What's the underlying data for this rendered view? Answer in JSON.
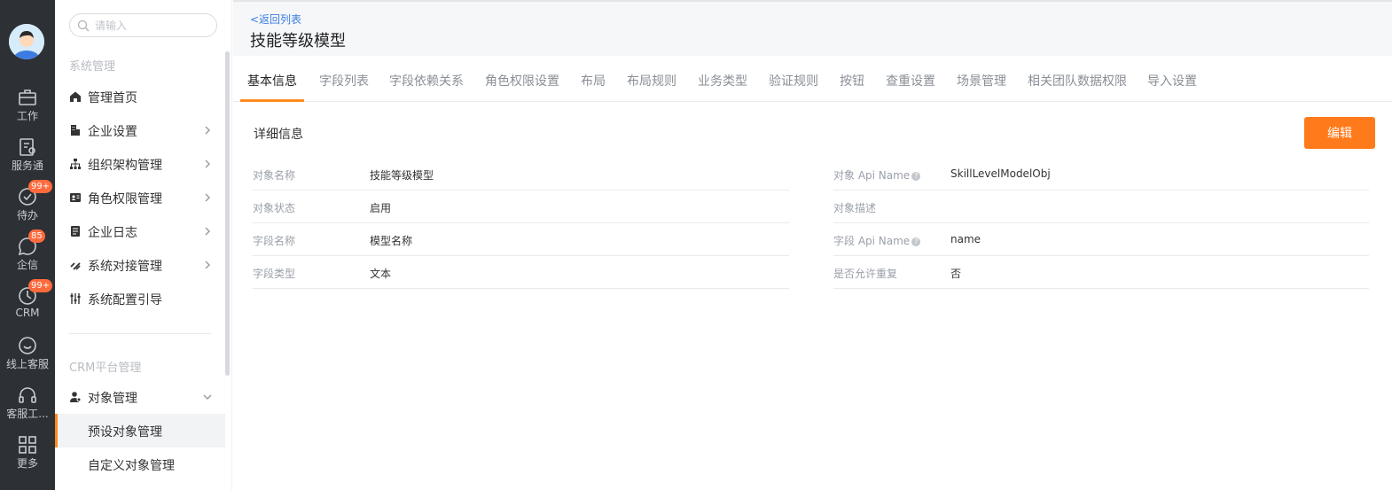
{
  "rail": {
    "items": [
      {
        "label": "工作",
        "icon": "briefcase-icon"
      },
      {
        "label": "服务通",
        "icon": "service-icon"
      },
      {
        "label": "待办",
        "icon": "check-circle-icon",
        "badge": "99+"
      },
      {
        "label": "企信",
        "icon": "chat-icon",
        "badge": "85"
      },
      {
        "label": "CRM",
        "icon": "crm-icon",
        "badge": "99+"
      },
      {
        "label": "线上客服",
        "icon": "online-service-icon"
      },
      {
        "label": "客服工...",
        "icon": "headset-icon"
      },
      {
        "label": "更多",
        "icon": "grid-icon"
      }
    ]
  },
  "sidebar": {
    "search_placeholder": "请输入",
    "group1_title": "系统管理",
    "items": [
      {
        "label": "管理首页",
        "icon": "home-icon"
      },
      {
        "label": "企业设置",
        "icon": "company-icon"
      },
      {
        "label": "组织架构管理",
        "icon": "org-icon"
      },
      {
        "label": "角色权限管理",
        "icon": "role-icon"
      },
      {
        "label": "企业日志",
        "icon": "log-icon"
      },
      {
        "label": "系统对接管理",
        "icon": "link-icon"
      },
      {
        "label": "系统配置引导",
        "icon": "settings-sliders-icon"
      }
    ],
    "group2_title": "CRM平台管理",
    "object_mgmt": "对象管理",
    "sub_items": [
      "预设对象管理",
      "自定义对象管理"
    ]
  },
  "header": {
    "back": "<返回列表",
    "title": "技能等级模型"
  },
  "tabs": [
    "基本信息",
    "字段列表",
    "字段依赖关系",
    "角色权限设置",
    "布局",
    "布局规则",
    "业务类型",
    "验证规则",
    "按钮",
    "查重设置",
    "场景管理",
    "相关团队数据权限",
    "导入设置"
  ],
  "detail": {
    "section_title": "详细信息",
    "edit_label": "编辑",
    "left": [
      {
        "label": "对象名称",
        "value": "技能等级模型"
      },
      {
        "label": "对象状态",
        "value": "启用"
      },
      {
        "label": "字段名称",
        "value": "模型名称"
      },
      {
        "label": "字段类型",
        "value": "文本"
      }
    ],
    "right": [
      {
        "label": "对象 Api Name",
        "value": "SkillLevelModelObj",
        "help": true
      },
      {
        "label": "对象描述",
        "value": ""
      },
      {
        "label": "字段 Api Name",
        "value": "name",
        "help": true
      },
      {
        "label": "是否允许重复",
        "value": "否"
      }
    ]
  },
  "colors": {
    "accent": "#ff7a1a",
    "link": "#3a7ce0",
    "rail_bg": "#2d3035",
    "badge": "#ff6a3d"
  }
}
